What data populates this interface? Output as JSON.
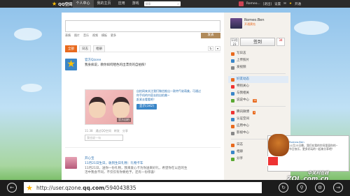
{
  "topnav": {
    "brand": "QQ空间",
    "items": [
      "个人中心",
      "我的主页",
      "应用",
      "游戏"
    ],
    "search_placeholder": "搜索",
    "username": "Romeo...",
    "links": [
      "[退出]",
      "设置",
      "开通"
    ]
  },
  "composer": {
    "tools": [
      "表情",
      "图片",
      "音乐",
      "视频",
      "模板",
      "更多"
    ],
    "publish": "发表"
  },
  "filters": {
    "tabs": [
      "全部",
      "日志",
      "相册"
    ]
  },
  "posts": [
    {
      "name": "官方Qzone",
      "text": "我身疯说，教你如何晒色的出漂亮的自拍照！",
      "app_title": "自拍网来关注我们微信推出一款特气软萌美，可通过你手机的内容去拍自拍美~",
      "app_more": "赶紧去看看吧！",
      "view_btn": "显示(342)",
      "photo_caption": "官方自拍",
      "time": "11:38",
      "meta": [
        "通过QQ空间",
        "转发",
        "分享"
      ],
      "comment_placeholder": "我也说一句"
    },
    {
      "name": "开心宝",
      "text": "11月21日生日，收到生日礼物：礼物卡车",
      "text2": "11月21日，送你一份礼物，我来爱心卡为你送来好礼，希望你在以后的生活中我会不同，不仅仅有你要给予，还有一份惊喜!"
    }
  ],
  "profile": {
    "name": "Romeo.Ben",
    "sub": "开通黄钻",
    "date": "11月23",
    "signin": "签到",
    "count": "34"
  },
  "menu1": [
    "写日志",
    "上传照片",
    "发视频"
  ],
  "menu2": [
    "好友动态",
    "特别关心",
    "与我相关",
    "说说中心"
  ],
  "menu2_badge": "14",
  "menu3": [
    "腾讯微博",
    "认证空间",
    "应用中心",
    "影视中心"
  ],
  "menu3_badge": "1",
  "menu4": [
    "日志",
    "相册",
    "分享"
  ],
  "popup": {
    "title": "Romeo.Ben",
    "lines": [
      "11月23日晚，我们在我的空间里面你的~",
      "节日快乐，更多好玩的一起来分享吧！"
    ]
  },
  "watermark": "ZOL.com.cn",
  "watermark2": "中关村在线",
  "url": {
    "prefix": "http://user.qzone.",
    "domain": "qq.com",
    "suffix": "/594043835"
  }
}
